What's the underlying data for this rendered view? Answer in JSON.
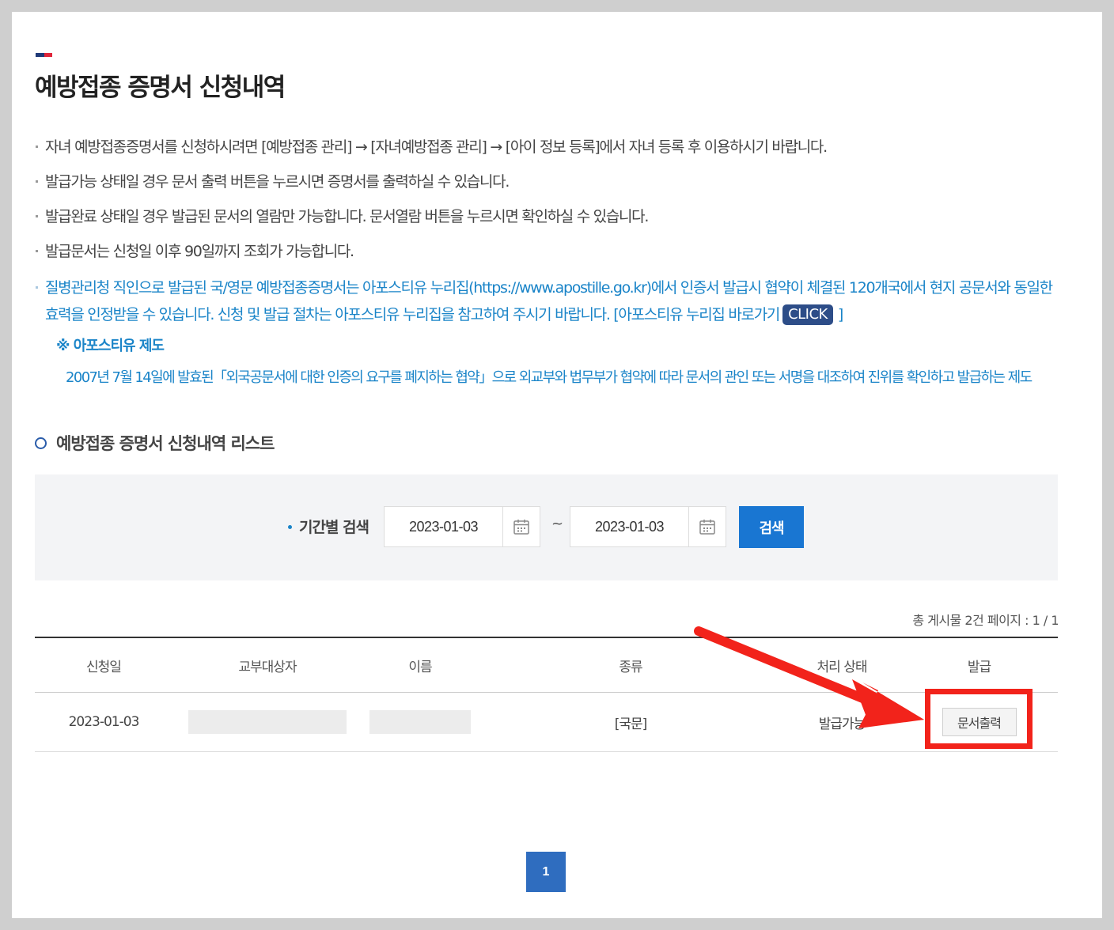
{
  "page": {
    "title": "예방접종 증명서 신청내역",
    "flag_colors": [
      "#1f3a78",
      "#e0253a"
    ]
  },
  "notes": [
    "자녀 예방접종증명서를 신청하시려면 [예방접종 관리] → [자녀예방접종 관리] → [아이 정보 등록]에서 자녀 등록 후 이용하시기 바랍니다.",
    "발급가능 상태일 경우 문서 출력 버튼을 누르시면 증명서를 출력하실 수 있습니다.",
    "발급완료 상태일 경우 발급된 문서의 열람만 가능합니다. 문서열람 버튼을 누르시면 확인하실 수 있습니다.",
    "발급문서는 신청일 이후 90일까지 조회가 가능합니다."
  ],
  "apostille": {
    "note": "질병관리청 직인으로 발급된 국/영문 예방접종증명서는 아포스티유 누리집(https://www.apostille.go.kr)에서 인증서 발급시 협약이 체결된 120개국에서 현지 공문서와 동일한 효력을 인정받을 수 있습니다. 신청 및 발급 절차는 아포스티유 누리집을 참고하여 주시기 바랍니다. [아포스티유 누리집 바로가기",
    "click_label": "CLICK",
    "close_bracket": "]",
    "heading": "※ 아포스티유 제도",
    "description": "2007년 7월 14일에 발효된「외국공문서에 대한 인증의 요구를 폐지하는 협약」으로 외교부와 법무부가 협약에 따라 문서의 관인 또는 서명을 대조하여 진위를 확인하고 발급하는 제도"
  },
  "list": {
    "heading": "예방접종 증명서 신청내역 리스트"
  },
  "search": {
    "label": "기간별 검색",
    "start_date": "2023-01-03",
    "end_date": "2023-01-03",
    "separator": "~",
    "button_label": "검색"
  },
  "summary": {
    "text": "총 게시물  2건    페이지 : 1 / 1"
  },
  "table": {
    "headers": [
      "신청일",
      "교부대상자",
      "이름",
      "종류",
      "처리 상태",
      "발급"
    ],
    "rows": [
      {
        "date": "2023-01-03",
        "recipient": "",
        "name": "",
        "type": "[국문]",
        "status": "발급가능",
        "action_label": "문서출력"
      }
    ]
  },
  "pagination": {
    "current": "1"
  },
  "annotation": {
    "color": "#f2231b"
  }
}
